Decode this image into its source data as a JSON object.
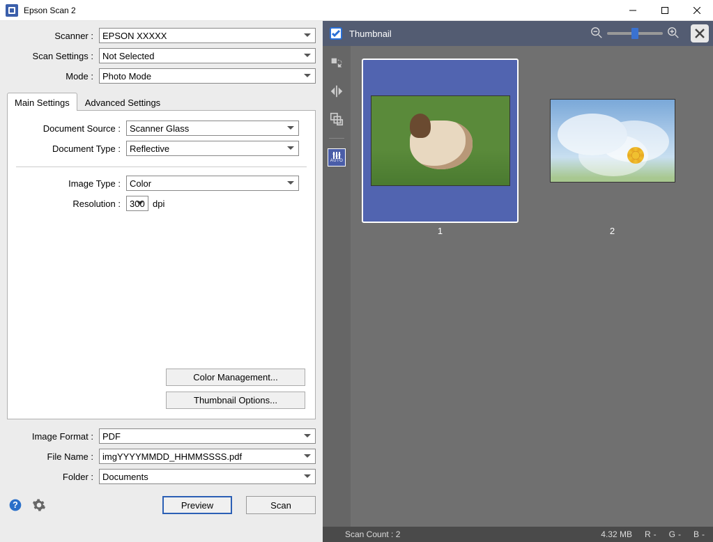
{
  "window": {
    "title": "Epson Scan 2"
  },
  "left": {
    "scanner": {
      "label": "Scanner :",
      "value": "EPSON XXXXX"
    },
    "scan_settings": {
      "label": "Scan Settings :",
      "value": "Not Selected"
    },
    "mode": {
      "label": "Mode :",
      "value": "Photo Mode"
    },
    "tabs": {
      "main": "Main Settings",
      "advanced": "Advanced Settings"
    },
    "main_settings": {
      "document_source": {
        "label": "Document Source :",
        "value": "Scanner Glass"
      },
      "document_type": {
        "label": "Document Type :",
        "value": "Reflective"
      },
      "image_type": {
        "label": "Image Type :",
        "value": "Color"
      },
      "resolution": {
        "label": "Resolution :",
        "value": "300",
        "unit": "dpi"
      },
      "color_mgmt_btn": "Color Management...",
      "thumb_opts_btn": "Thumbnail Options..."
    },
    "output": {
      "image_format": {
        "label": "Image Format :",
        "value": "PDF"
      },
      "file_name": {
        "label": "File Name :",
        "value": "imgYYYYMMDD_HHMMSSSS.pdf"
      },
      "folder": {
        "label": "Folder :",
        "value": "Documents"
      }
    },
    "actions": {
      "preview": "Preview",
      "scan": "Scan"
    }
  },
  "right": {
    "thumbnail_label": "Thumbnail",
    "thumbnails": [
      {
        "index": "1",
        "selected": true
      },
      {
        "index": "2",
        "selected": false
      }
    ],
    "auto_label": "AUTO"
  },
  "status": {
    "scan_count": "Scan Count : 2",
    "size": "4.32 MB",
    "r": "R",
    "g": "G",
    "b": "B",
    "dash": "-"
  }
}
